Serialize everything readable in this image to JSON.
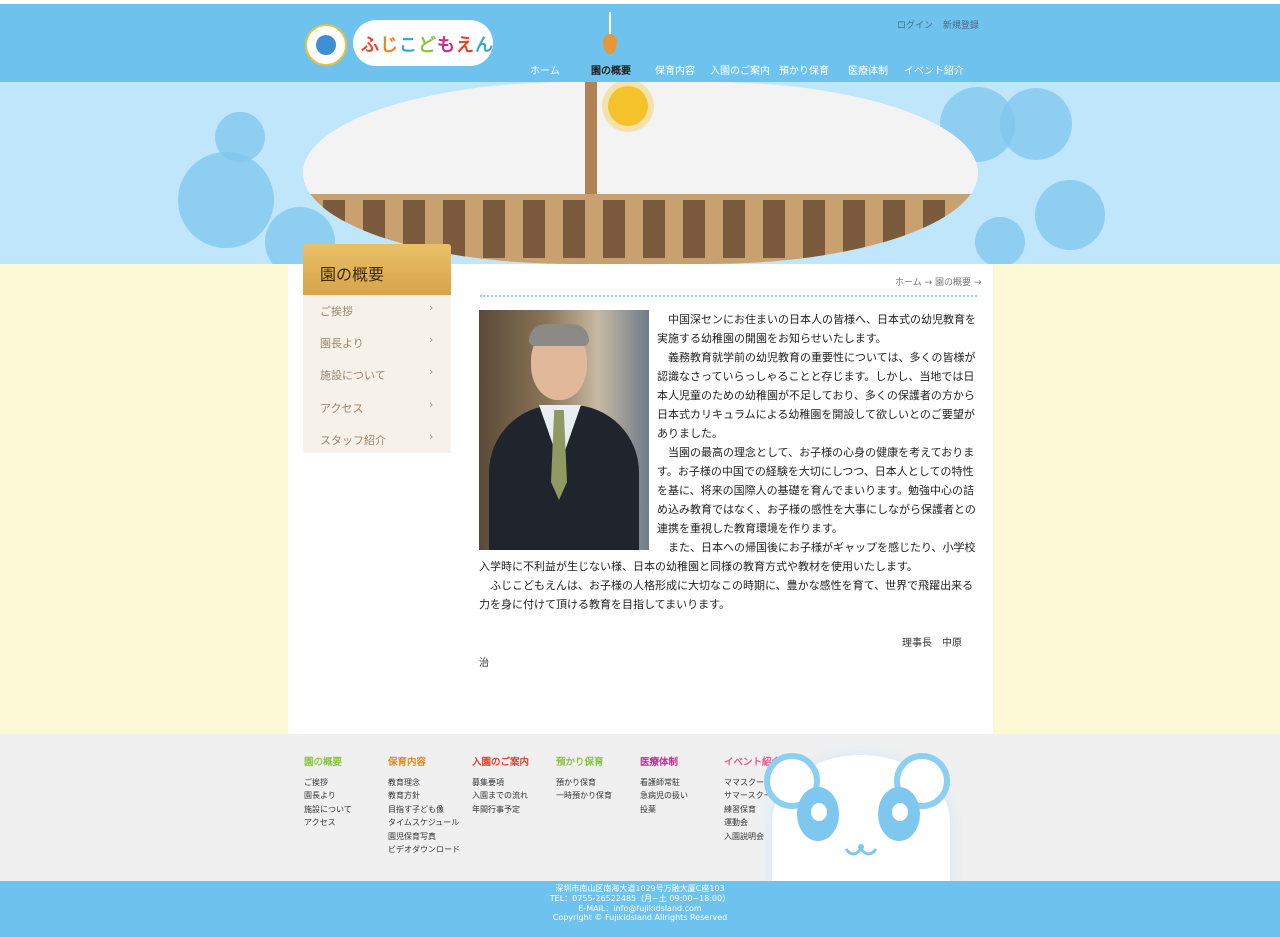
{
  "header": {
    "logo_text": "ふじこどもえん",
    "login": "ログイン",
    "register": "新規登録",
    "nav": [
      {
        "label": "ホーム",
        "active": false
      },
      {
        "label": "園の概要",
        "active": true
      },
      {
        "label": "保育内容",
        "active": false
      },
      {
        "label": "入園のご案内",
        "active": false
      },
      {
        "label": "預かり保育",
        "active": false
      },
      {
        "label": "医療体制",
        "active": false
      },
      {
        "label": "イベント紹介",
        "active": false
      }
    ]
  },
  "sidebar": {
    "title": "園の概要",
    "items": [
      {
        "label": "ご挨拶"
      },
      {
        "label": "園長より"
      },
      {
        "label": "施設について"
      },
      {
        "label": "アクセス"
      },
      {
        "label": "スタッフ紹介"
      }
    ],
    "chevron": "›"
  },
  "breadcrumb": "ホーム → 園の概要 →",
  "content": {
    "paragraphs": [
      "　中国深センにお住まいの日本人の皆様へ、日本式の幼児教育を実施する幼稚園の開園をお知らせいたします。",
      "　義務教育就学前の幼児教育の重要性については、多くの皆様が認識なさっていらっしゃることと存じます。しかし、当地では日本人児童のための幼稚園が不足しており、多くの保護者の方から日本式カリキュラムによる幼稚園を開設して欲しいとのご要望がありました。",
      "　当園の最高の理念として、お子様の心身の健康を考えております。お子様の中国での経験を大切にしつつ、日本人としての特性を基に、将来の国際人の基礎を育んでまいります。勉強中心の詰め込み教育ではなく、お子様の感性を大事にしながら保護者との連携を重視した教育環境を作ります。",
      "　また、日本への帰国後にお子様がギャップを感じたり、小学校入学時に不利益が生じない様、日本の幼稚園と同様の教育方式や教材を使用いたします。",
      "　ふじこどもえんは、お子様の人格形成に大切なこの時期に、豊かな感性を育て、世界で飛躍出来る力を身に付けて頂ける教育を目指してまいります。"
    ],
    "signature_line1": "理事長　中原",
    "signature_line2": "治"
  },
  "footer": {
    "columns": [
      {
        "heading": "園の概要",
        "color": "#8bc53f",
        "links": [
          "ご挨拶",
          "園長より",
          "施設について",
          "アクセス"
        ]
      },
      {
        "heading": "保育内容",
        "color": "#e8871e",
        "links": [
          "教育理念",
          "教育方針",
          "目指す子ども像",
          "タイムスケジュール",
          "園児保育写真",
          "ビデオダウンロード"
        ]
      },
      {
        "heading": "入園のご案内",
        "color": "#e0442e",
        "links": [
          "募集要項",
          "入園までの流れ",
          "年間行事予定"
        ]
      },
      {
        "heading": "預かり保育",
        "color": "#8bc53f",
        "links": [
          "預かり保育",
          "一時預かり保育"
        ]
      },
      {
        "heading": "医療体制",
        "color": "#c22f8f",
        "links": [
          "看護師常駐",
          "急病児の扱い",
          "投薬"
        ]
      },
      {
        "heading": "イベント紹介",
        "color": "#e8588a",
        "links": [
          "ママスクール",
          "サマースクール",
          "練習保育",
          "運動会",
          "入園説明会"
        ]
      }
    ],
    "address": "深圳市南山区南海大道1029号万融大厦C座103",
    "tel": "TEL：0755-26522485（月~土 09:00~18:00）",
    "email": "E-MAIL：info@fujikidsland.com",
    "copyright": "Copyright © Fujikidsland Allrights Reserved"
  },
  "colors": {
    "sky": "#6dc3ee",
    "cream": "#fdf8d6",
    "gold": "#d8a449"
  }
}
